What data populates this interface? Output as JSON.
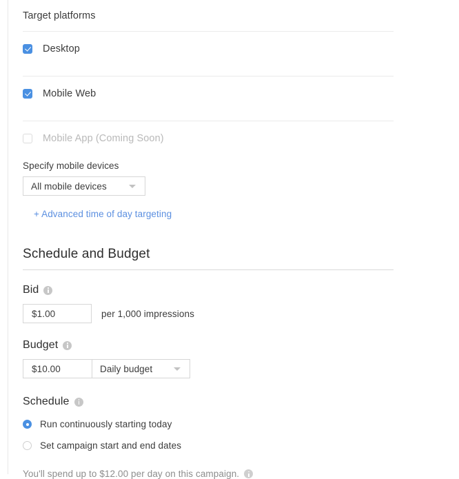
{
  "target_platforms": {
    "section_label": "Target platforms",
    "rows": [
      {
        "label": "Desktop",
        "checked": true,
        "disabled": false
      },
      {
        "label": "Mobile Web",
        "checked": true,
        "disabled": false
      },
      {
        "label": "Mobile App (Coming Soon)",
        "checked": false,
        "disabled": true
      }
    ],
    "mobile_devices": {
      "label": "Specify mobile devices",
      "selected": "All mobile devices",
      "caret_icon": "chevron-down-icon"
    },
    "advanced_link": "+ Advanced time of day targeting"
  },
  "schedule_and_budget": {
    "heading": "Schedule and Budget",
    "bid": {
      "label": "Bid",
      "info_icon": "info-icon",
      "value": "$1.00",
      "suffix": "per 1,000 impressions"
    },
    "budget": {
      "label": "Budget",
      "info_icon": "info-icon",
      "value": "$10.00",
      "type_selected": "Daily budget",
      "caret_icon": "chevron-down-icon"
    },
    "schedule": {
      "label": "Schedule",
      "info_icon": "info-icon",
      "options": [
        {
          "label": "Run continuously starting today",
          "selected": true
        },
        {
          "label": "Set campaign start and end dates",
          "selected": false
        }
      ]
    },
    "spend_note": {
      "text": "You'll spend up to $12.00 per day on this campaign.",
      "info_icon": "info-icon"
    }
  },
  "colors": {
    "accent_blue": "#4a90e2",
    "link_blue": "#5b8fe0",
    "text": "#3b3b3b",
    "muted": "#b9b9b9",
    "border": "#d6d6d6",
    "divider": "#ebebeb"
  }
}
